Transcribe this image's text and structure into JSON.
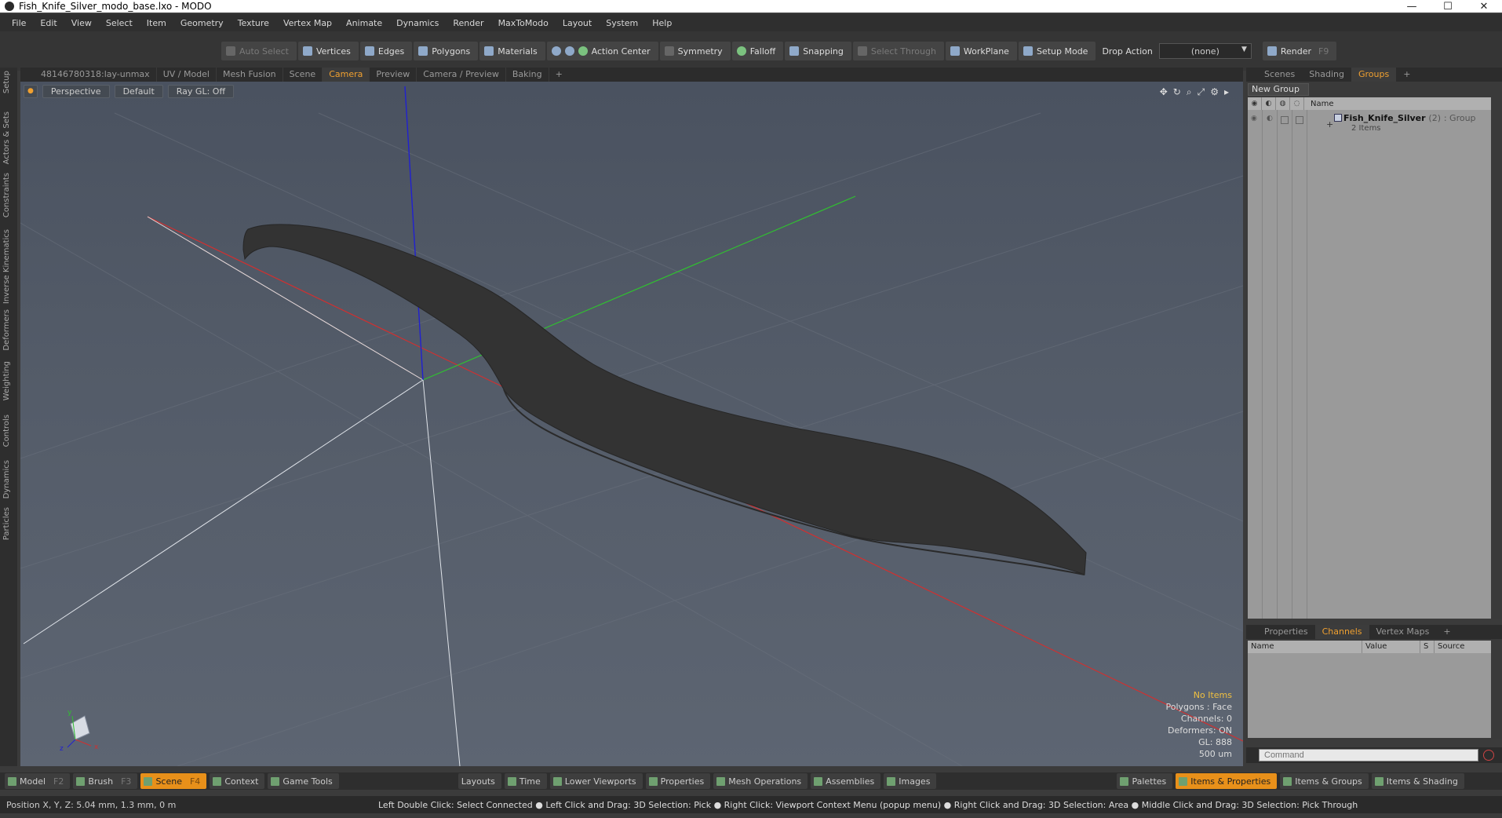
{
  "window": {
    "title": "Fish_Knife_Silver_modo_base.lxo - MODO",
    "minimize": "—",
    "maximize": "☐",
    "close": "✕"
  },
  "menu": [
    "File",
    "Edit",
    "View",
    "Select",
    "Item",
    "Geometry",
    "Texture",
    "Vertex Map",
    "Animate",
    "Dynamics",
    "Render",
    "MaxToModo",
    "Layout",
    "System",
    "Help"
  ],
  "toolbar": {
    "auto_select": "Auto Select",
    "vertices": "Vertices",
    "edges": "Edges",
    "polygons": "Polygons",
    "materials": "Materials",
    "action_center": "Action Center",
    "symmetry": "Symmetry",
    "falloff": "Falloff",
    "snapping": "Snapping",
    "select_through": "Select Through",
    "workplane": "WorkPlane",
    "setup_mode": "Setup Mode",
    "drop_action_label": "Drop Action",
    "drop_action_value": "(none)",
    "render": "Render",
    "render_key": "F9"
  },
  "left_tabs": [
    "Setup",
    "Actors & Sets",
    "Constraints",
    "Inverse Kinematics",
    "Deformers",
    "Weighting",
    "Controls",
    "Dynamics",
    "Particles"
  ],
  "viewport_tabs": [
    "48146780318:lay-unmax",
    "UV / Model",
    "Mesh Fusion",
    "Scene",
    "Camera",
    "Preview",
    "Camera / Preview",
    "Baking",
    "+"
  ],
  "viewport": {
    "projection": "Perspective",
    "shading": "Default",
    "raygl": "Ray GL: Off",
    "axis_label_y": "y",
    "axis_label_x": "x",
    "axis_label_z": "z",
    "info": {
      "items": "No Items",
      "polygons": "Polygons : Face",
      "channels": "Channels: 0",
      "deformers": "Deformers: ON",
      "gl": "GL: 888",
      "scale": "500 um"
    }
  },
  "right_tabs": [
    "Scenes",
    "Shading",
    "Groups",
    "+"
  ],
  "groups": {
    "new_group": "New Group",
    "column_name": "Name",
    "item": {
      "name": "Fish_Knife_Silver",
      "count": "(2)",
      "type": ": Group",
      "sub": "2 Items"
    }
  },
  "channel_tabs": [
    "Properties",
    "Channels",
    "Vertex Maps",
    "+"
  ],
  "channels": {
    "columns": [
      "Name",
      "Value",
      "S",
      "Source"
    ]
  },
  "command": {
    "placeholder": "Command"
  },
  "bottom": {
    "model": "Model",
    "model_key": "F2",
    "brush": "Brush",
    "brush_key": "F3",
    "scene": "Scene",
    "scene_key": "F4",
    "context": "Context",
    "game_tools": "Game Tools",
    "layouts": "Layouts",
    "time": "Time",
    "lower_viewports": "Lower Viewports",
    "properties": "Properties",
    "mesh_operations": "Mesh Operations",
    "assemblies": "Assemblies",
    "images": "Images",
    "palettes": "Palettes",
    "items_properties": "Items & Properties",
    "items_groups": "Items & Groups",
    "items_shading": "Items & Shading"
  },
  "status": {
    "position": "Position X, Y, Z:   5.04 mm, 1.3 mm, 0 m",
    "hint": "Left Double Click: Select Connected ● Left Click and Drag: 3D Selection: Pick ● Right Click: Viewport Context Menu (popup menu) ● Right Click and Drag: 3D Selection: Area ● Middle Click and Drag: 3D Selection: Pick Through"
  },
  "colors": {
    "accent": "#f0a030",
    "axis_x": "#d03030",
    "axis_y": "#30c030",
    "axis_z": "#2020d0",
    "mesh": "#353535"
  }
}
